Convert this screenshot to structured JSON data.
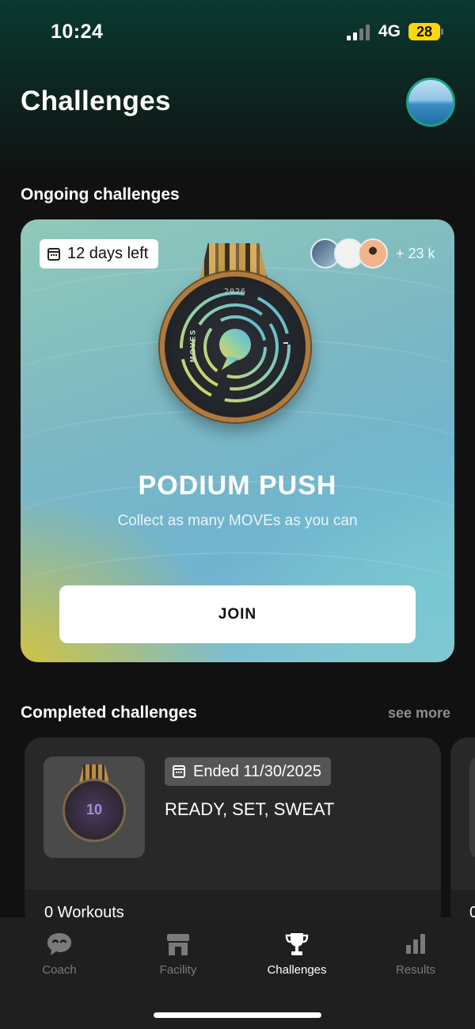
{
  "status_bar": {
    "time": "10:24",
    "network": "4G",
    "battery": "28"
  },
  "header": {
    "title": "Challenges"
  },
  "ongoing": {
    "section_title": "Ongoing challenges",
    "challenge": {
      "days_left": "12 days left",
      "participants_more": "+ 23 k",
      "medal_year": "2026",
      "medal_brand": "MOVES",
      "name": "PODIUM PUSH",
      "description": "Collect as many MOVEs as you can",
      "join_label": "JOIN"
    }
  },
  "completed": {
    "section_title": "Completed challenges",
    "see_more": "see more",
    "items": [
      {
        "ended": "Ended 11/30/2025",
        "name": "READY, SET, SWEAT",
        "workouts": "0 Workouts",
        "medal_number": "10"
      }
    ],
    "next_peek_text": "0"
  },
  "tabs": [
    {
      "label": "Coach",
      "icon": "chat-bubble-icon",
      "active": false
    },
    {
      "label": "Facility",
      "icon": "storefront-icon",
      "active": false
    },
    {
      "label": "Challenges",
      "icon": "trophy-icon",
      "active": true
    },
    {
      "label": "Results",
      "icon": "bar-chart-icon",
      "active": false
    }
  ],
  "colors": {
    "background": "#111111",
    "card": "#282828",
    "accent_ring": "#1aa08a",
    "battery": "#ffd60a"
  }
}
